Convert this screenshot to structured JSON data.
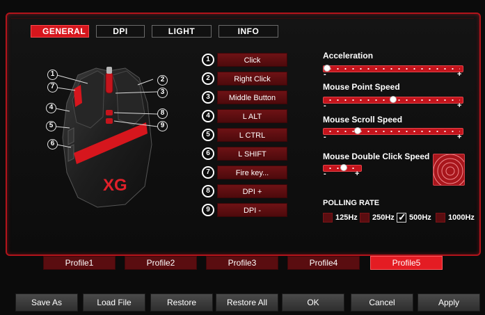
{
  "tabs": [
    "GENERAL",
    "DPI",
    "LIGHT",
    "INFO"
  ],
  "callouts": [
    "1",
    "2",
    "3",
    "4",
    "5",
    "6",
    "7",
    "8",
    "9"
  ],
  "brand_logo": "XG",
  "keys": [
    {
      "num": "1",
      "label": "Click"
    },
    {
      "num": "2",
      "label": "Right Click"
    },
    {
      "num": "3",
      "label": "Middle Button"
    },
    {
      "num": "4",
      "label": "L ALT"
    },
    {
      "num": "5",
      "label": "L CTRL"
    },
    {
      "num": "6",
      "label": "L SHIFT"
    },
    {
      "num": "7",
      "label": "Fire key..."
    },
    {
      "num": "8",
      "label": "DPI +"
    },
    {
      "num": "9",
      "label": "DPI -"
    }
  ],
  "settings": {
    "acceleration": {
      "label": "Acceleration",
      "level": 0.0
    },
    "point_speed": {
      "label": "Mouse Point Speed",
      "level": 0.5
    },
    "scroll_speed": {
      "label": "Mouse Scroll Speed",
      "level": 0.23
    },
    "double_click": {
      "label": "Mouse Double Click Speed",
      "level": 0.55
    },
    "minus": "-",
    "plus": "+"
  },
  "polling": {
    "label": "POLLING RATE",
    "options": [
      "125Hz",
      "250Hz",
      "500Hz",
      "1000Hz"
    ],
    "selected": "500Hz"
  },
  "profiles": [
    "Profile1",
    "Profile2",
    "Profile3",
    "Profile4",
    "Profile5"
  ],
  "active_profile": "Profile5",
  "buttons": [
    "Save As",
    "Load File",
    "Restore",
    "Restore All",
    "OK",
    "Cancel",
    "Apply"
  ],
  "colors": {
    "accent": "#d6161d",
    "background": "#0b0b0b"
  }
}
